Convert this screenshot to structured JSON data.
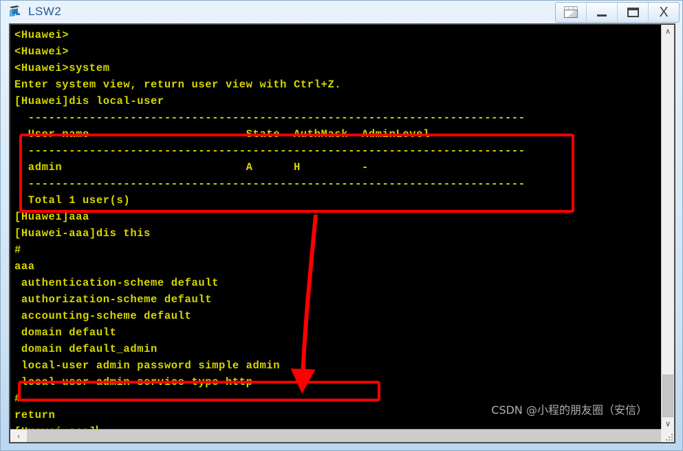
{
  "window": {
    "title": "LSW2",
    "icon": "switch-device-icon",
    "buttons": [
      {
        "name": "restore-all-button",
        "glyph": "restore-all-icon",
        "label": ""
      },
      {
        "name": "minimize-button",
        "glyph": "minimize-icon",
        "label": ""
      },
      {
        "name": "maximize-button",
        "glyph": "maximize-icon",
        "label": ""
      },
      {
        "name": "close-button",
        "glyph": "close-icon",
        "label": "X"
      }
    ]
  },
  "terminal": {
    "foreground_color": "#d7d700",
    "background_color": "#000000",
    "lines": [
      "<Huawei>",
      "<Huawei>",
      "<Huawei>system",
      "Enter system view, return user view with Ctrl+Z.",
      "[Huawei]dis local-user",
      "  -------------------------------------------------------------------------",
      "  User-name                       State  AuthMask  AdminLevel",
      "  -------------------------------------------------------------------------",
      "  admin                           A      H         -",
      "  -------------------------------------------------------------------------",
      "  Total 1 user(s)",
      "[Huawei]aaa",
      "[Huawei-aaa]dis this",
      "#",
      "aaa",
      " authentication-scheme default",
      " authorization-scheme default",
      " accounting-scheme default",
      " domain default",
      " domain default_admin",
      " local-user admin password simple admin",
      " local-user admin service-type http",
      "#",
      "return",
      "[Huawei-aaa]"
    ],
    "prompt_last": "[Huawei-aaa]",
    "user_table": {
      "headers": [
        "User-name",
        "State",
        "AuthMask",
        "AdminLevel"
      ],
      "rows": [
        [
          "admin",
          "A",
          "H",
          "-"
        ]
      ],
      "total_text": "Total 1 user(s)"
    },
    "commands_entered": [
      "system",
      "dis local-user",
      "aaa",
      "dis this"
    ]
  },
  "scrollbars": {
    "vertical": {
      "up_arrow": "∧",
      "down_arrow": "∨"
    },
    "horizontal": {
      "left_arrow": "‹"
    }
  },
  "annotations": {
    "color": "#ff0000",
    "box_1_target": "user-table-highlight",
    "box_2_target": "local-user-password-line-highlight",
    "arrow": "points from user table down to local-user admin password simple admin line"
  },
  "watermark": {
    "text": "CSDN @小程的朋友圈（安信）"
  }
}
